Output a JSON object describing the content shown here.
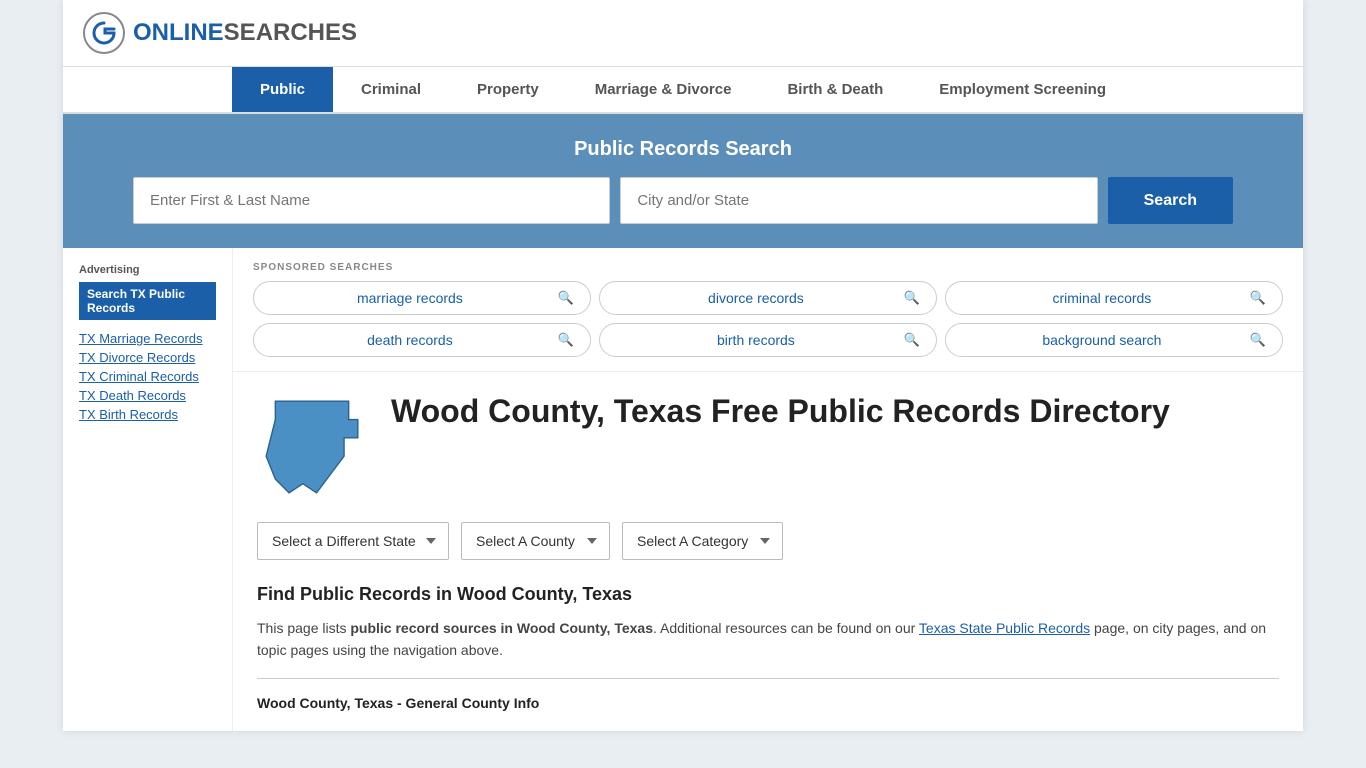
{
  "logo": {
    "text_online": "ONLINE",
    "text_searches": "SEARCHES"
  },
  "nav": {
    "items": [
      {
        "label": "Public",
        "active": true
      },
      {
        "label": "Criminal",
        "active": false
      },
      {
        "label": "Property",
        "active": false
      },
      {
        "label": "Marriage & Divorce",
        "active": false
      },
      {
        "label": "Birth & Death",
        "active": false
      },
      {
        "label": "Employment Screening",
        "active": false
      }
    ]
  },
  "search_banner": {
    "title": "Public Records Search",
    "name_placeholder": "Enter First & Last Name",
    "location_placeholder": "City and/or State",
    "button_label": "Search"
  },
  "sponsored": {
    "label": "SPONSORED SEARCHES",
    "items": [
      {
        "label": "marriage records"
      },
      {
        "label": "divorce records"
      },
      {
        "label": "criminal records"
      },
      {
        "label": "death records"
      },
      {
        "label": "birth records"
      },
      {
        "label": "background search"
      }
    ]
  },
  "county": {
    "title": "Wood County, Texas Free Public Records Directory"
  },
  "dropdowns": {
    "state_label": "Select a Different State",
    "county_label": "Select A County",
    "category_label": "Select A Category"
  },
  "find_section": {
    "heading": "Find Public Records in Wood County, Texas",
    "paragraph_start": "This page lists ",
    "bold_text": "public record sources in Wood County, Texas",
    "paragraph_mid": ". Additional resources can be found on our ",
    "link_text": "Texas State Public Records",
    "paragraph_end": " page, on city pages, and on topic pages using the navigation above."
  },
  "county_info": {
    "heading": "Wood County, Texas - General County Info"
  },
  "sidebar": {
    "advertising_label": "Advertising",
    "ad_button": "Search TX Public Records",
    "links": [
      {
        "label": "TX Marriage Records"
      },
      {
        "label": "TX Divorce Records"
      },
      {
        "label": "TX Criminal Records"
      },
      {
        "label": "TX Death Records"
      },
      {
        "label": "TX Birth Records"
      }
    ]
  }
}
